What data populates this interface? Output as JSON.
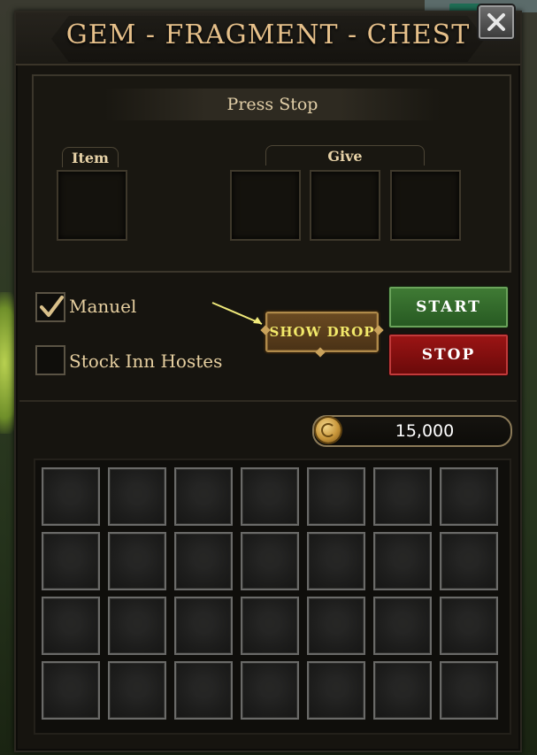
{
  "window": {
    "title": "GEM - FRAGMENT - CHEST",
    "close_icon": "close-icon"
  },
  "exchange": {
    "status_text": "Press Stop",
    "item_label": "Item",
    "give_label": "Give",
    "item_slots": 1,
    "give_slots": 3
  },
  "options": [
    {
      "label": "Manuel",
      "checked": true
    },
    {
      "label": "Stock Inn Hostes",
      "checked": false
    }
  ],
  "buttons": {
    "show_drop": "SHOW DROP",
    "start": "START",
    "stop": "STOP"
  },
  "currency": {
    "icon": "coin-icon",
    "value": "15,000"
  },
  "inventory": {
    "columns": 7,
    "rows": 4
  },
  "colors": {
    "title_gold": "#e6c08a",
    "show_drop_text": "#f2e96a",
    "start_green": "#3f7a34",
    "stop_red": "#9a1414"
  }
}
